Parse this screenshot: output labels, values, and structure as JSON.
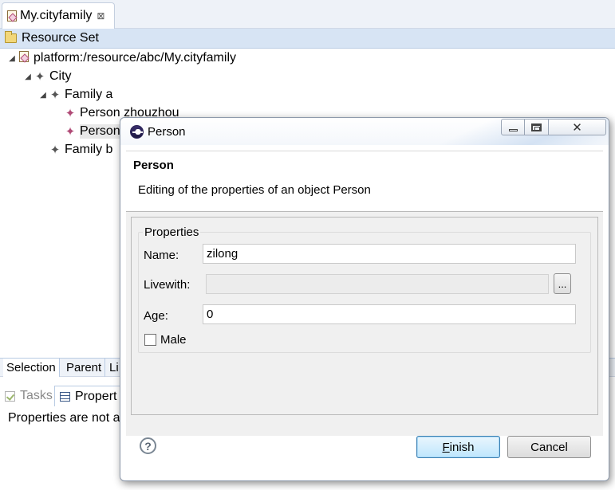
{
  "editor": {
    "tab_label": "My.cityfamily",
    "resource_set_label": "Resource Set",
    "tree": [
      {
        "label": "platform:/resource/abc/My.cityfamily",
        "icon": "model-file-icon",
        "expanded": true
      },
      {
        "label": "City",
        "icon": "city-node-icon",
        "expanded": true
      },
      {
        "label": "Family a",
        "icon": "family-node-icon",
        "expanded": true
      },
      {
        "label": "Person zhouzhou",
        "icon": "person-node-icon"
      },
      {
        "label": "Person",
        "icon": "person-node-icon",
        "selected": true
      },
      {
        "label": "Family b",
        "icon": "family-node-icon",
        "expanded": false
      }
    ],
    "bottom_tabs": [
      {
        "label": "Selection",
        "active": true
      },
      {
        "label": "Parent"
      },
      {
        "label": "Li"
      }
    ]
  },
  "views": {
    "tasks_label": "Tasks",
    "properties_label": "Propert",
    "properties_message": "Properties are not a"
  },
  "dialog": {
    "title": "Person",
    "banner_title": "Person",
    "banner_description": "Editing of the properties of an object Person",
    "group_label": "Properties",
    "name_label": "Name:",
    "name_value": "zilong",
    "livewith_label": "Livewith:",
    "livewith_value": "",
    "browse_label": "...",
    "age_label": "Age:",
    "age_value": "0",
    "male_label": "Male",
    "male_checked": false,
    "finish_mnemonic": "F",
    "finish_rest": "inish",
    "cancel_label": "Cancel",
    "help_symbol": "?",
    "close_glyph": "✕"
  },
  "colors": {
    "resource_bar": "#d7e4f4",
    "finish_button": "#bee6fd",
    "dialog_content": "#f0f0f0",
    "person_icon": "#b04a76"
  }
}
